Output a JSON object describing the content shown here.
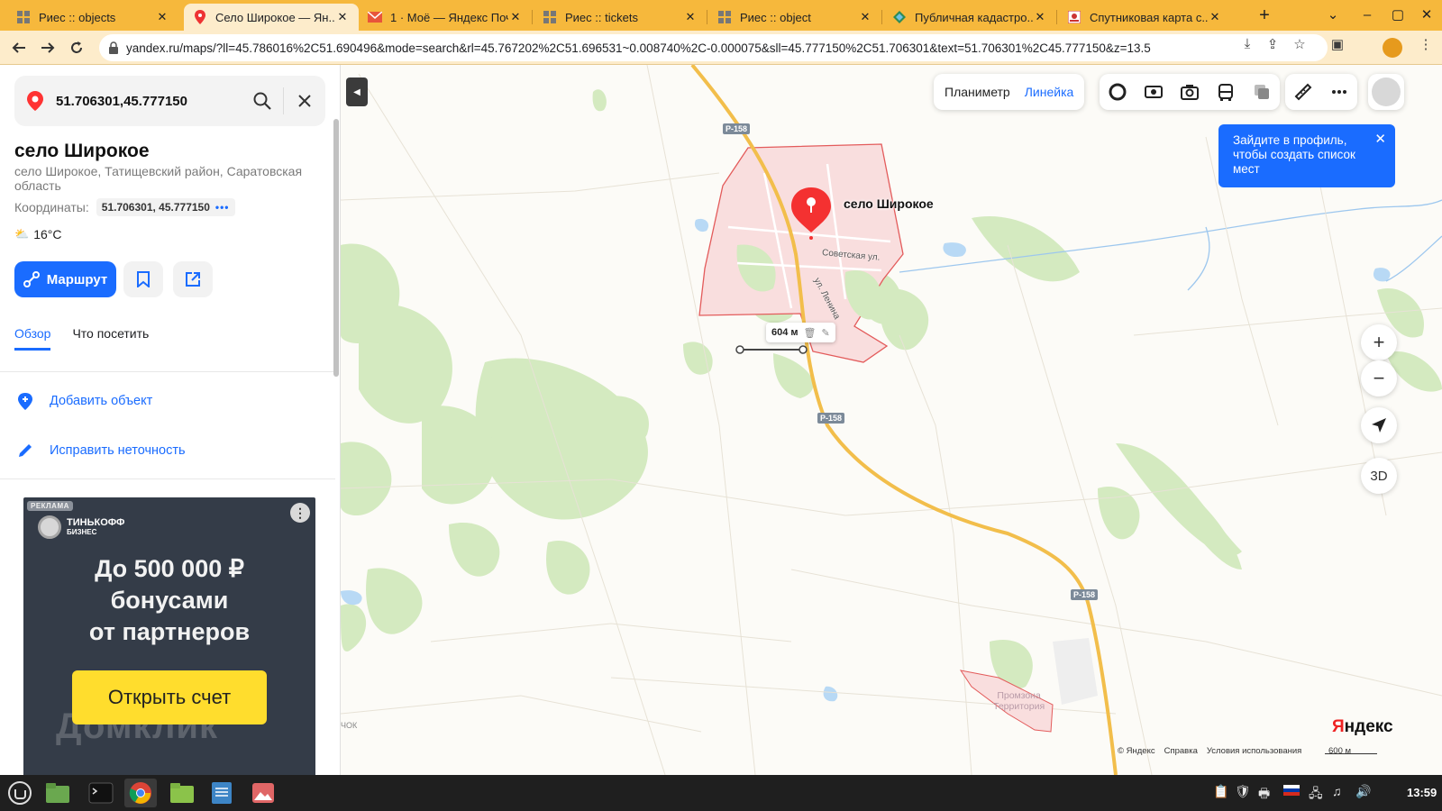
{
  "browser": {
    "tabs": [
      {
        "title": "Риес :: objects",
        "icon": "grid-icon"
      },
      {
        "title": "Село Широкое — Ян...",
        "icon": "location-pin-icon"
      },
      {
        "title": "1 · Моё — Яндекс Поч...",
        "icon": "mail-icon"
      },
      {
        "title": "Риес :: tickets",
        "icon": "grid-icon"
      },
      {
        "title": "Риес :: object",
        "icon": "grid-icon"
      },
      {
        "title": "Публичная кадастро...",
        "icon": "cadastre-icon"
      },
      {
        "title": "Спутниковая карта с...",
        "icon": "satellite-icon"
      }
    ],
    "active_tab": 1,
    "url": "yandex.ru/maps/?ll=45.786016%2C51.690496&mode=search&rl=45.767202%2C51.696531~0.008740%2C-0.000075&sll=45.777150%2C51.706301&text=51.706301%2C45.777150&z=13.5"
  },
  "sidebar": {
    "search_query": "51.706301,45.777150",
    "place_title": "село Широкое",
    "place_address": "село Широкое, Татищевский район, Саратовская область",
    "coords_label": "Координаты:",
    "coords_value": "51.706301, 45.777150",
    "coords_more": "•••",
    "weather": "16°C",
    "route_button": "Маршрут",
    "tabs": [
      "Обзор",
      "Что посетить"
    ],
    "actions": [
      {
        "label": "Добавить объект",
        "icon": "add-location-icon"
      },
      {
        "label": "Исправить неточность",
        "icon": "pencil-icon"
      }
    ]
  },
  "ad": {
    "tag": "РЕКЛАМА",
    "brand_line1": "ТИНЬКОФФ",
    "brand_line2": "БИЗНЕС",
    "headline_1": "До 500 000 ₽",
    "headline_2": "бонусами",
    "headline_3": "от партнеров",
    "cta": "Открыть счет",
    "watermark": "Домклик"
  },
  "map": {
    "tools": {
      "planimeter": "Планиметр",
      "ruler": "Линейка"
    },
    "layer_icons": [
      "traffic-icon",
      "panorama-icon",
      "camera-icon",
      "transit-icon",
      "layers-icon",
      "ruler-icon",
      "more-icon"
    ],
    "tooltip": "Зайдите в профиль, чтобы создать список мест",
    "place_label": "село Широкое",
    "ruler_distance": "604 м",
    "roads": [
      "Р-158",
      "Р-158",
      "Р-158"
    ],
    "streets": [
      "Советская ул.",
      "ул. Ленина"
    ],
    "zone_label_1": "Промзона",
    "zone_label_2": "Территория",
    "edge_label": "ЧОК",
    "zoom_in": "+",
    "zoom_out": "−",
    "btn_3d": "3D",
    "logo_red": "Я",
    "logo_rest": "ндекс",
    "copyright": [
      "© Яндекс",
      "Справка",
      "Условия использования"
    ],
    "scale": "600 м"
  },
  "taskbar": {
    "clock": "13:59",
    "apps": [
      "mint-menu-icon",
      "files-icon",
      "terminal-icon",
      "chrome-icon",
      "folder-icon",
      "writer-icon",
      "image-viewer-icon"
    ]
  },
  "colors": {
    "accent": "#1a6cff",
    "tabstrip": "#f6b83c",
    "village_fill": "#f9dede",
    "village_border": "#e35b5b",
    "forest": "#d6ecc4",
    "highway": "#f2be4b"
  }
}
